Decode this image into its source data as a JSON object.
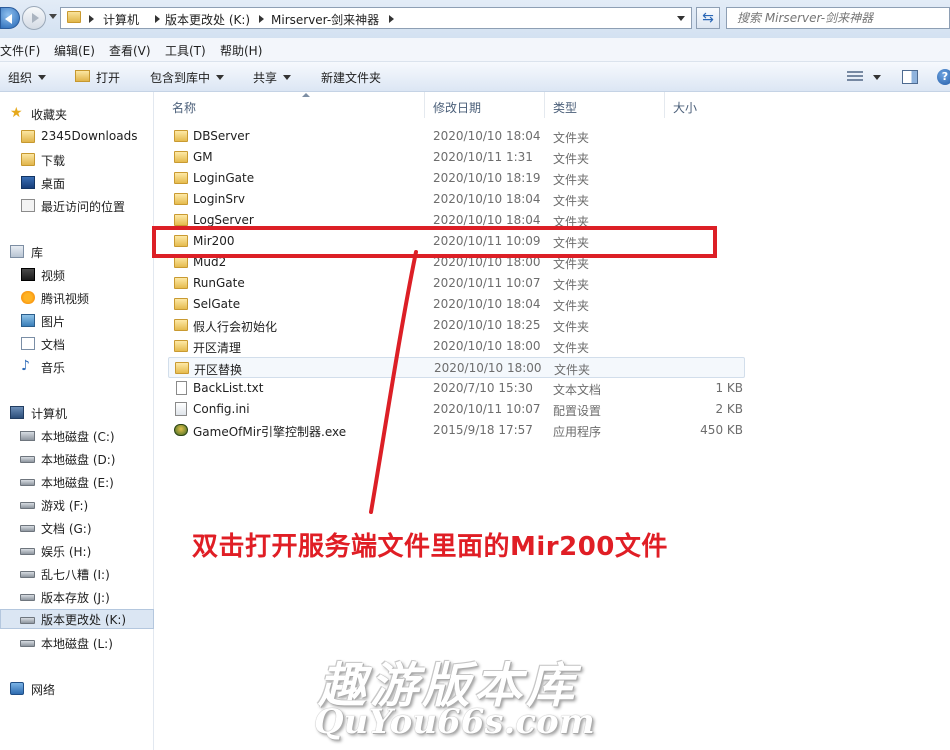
{
  "address_bar": {
    "breadcrumbs": [
      "计算机",
      "版本更改处 (K:)",
      "Mirserver-剑来神器"
    ],
    "search_placeholder": "搜索 Mirserver-剑来神器"
  },
  "menu": [
    "文件(F)",
    "编辑(E)",
    "查看(V)",
    "工具(T)",
    "帮助(H)"
  ],
  "toolbar": {
    "organize": "组织",
    "open": "打开",
    "include_library": "包含到库中",
    "share": "共享",
    "new_folder": "新建文件夹"
  },
  "sidebar": {
    "favorites": {
      "label": "收藏夹",
      "items": [
        "2345Downloads",
        "下载",
        "桌面",
        "最近访问的位置"
      ]
    },
    "libraries": {
      "label": "库",
      "items": [
        "视频",
        "腾讯视频",
        "图片",
        "文档",
        "音乐"
      ]
    },
    "computer": {
      "label": "计算机",
      "items": [
        "本地磁盘 (C:)",
        "本地磁盘 (D:)",
        "本地磁盘 (E:)",
        "游戏 (F:)",
        "文档 (G:)",
        "娱乐 (H:)",
        "乱七八糟 (I:)",
        "版本存放 (J:)",
        "版本更改处 (K:)",
        "本地磁盘 (L:)"
      ],
      "selected": "版本更改处 (K:)"
    },
    "network": {
      "label": "网络"
    }
  },
  "columns": {
    "name": "名称",
    "date": "修改日期",
    "type": "类型",
    "size": "大小"
  },
  "files": [
    {
      "name": "DBServer",
      "date": "2020/10/10 18:04",
      "type": "文件夹",
      "size": "",
      "icon": "folder"
    },
    {
      "name": "GM",
      "date": "2020/10/11 1:31",
      "type": "文件夹",
      "size": "",
      "icon": "folder"
    },
    {
      "name": "LoginGate",
      "date": "2020/10/10 18:19",
      "type": "文件夹",
      "size": "",
      "icon": "folder"
    },
    {
      "name": "LoginSrv",
      "date": "2020/10/10 18:04",
      "type": "文件夹",
      "size": "",
      "icon": "folder"
    },
    {
      "name": "LogServer",
      "date": "2020/10/10 18:04",
      "type": "文件夹",
      "size": "",
      "icon": "folder"
    },
    {
      "name": "Mir200",
      "date": "2020/10/11 10:09",
      "type": "文件夹",
      "size": "",
      "icon": "folder"
    },
    {
      "name": "Mud2",
      "date": "2020/10/10 18:00",
      "type": "文件夹",
      "size": "",
      "icon": "folder"
    },
    {
      "name": "RunGate",
      "date": "2020/10/11 10:07",
      "type": "文件夹",
      "size": "",
      "icon": "folder"
    },
    {
      "name": "SelGate",
      "date": "2020/10/10 18:04",
      "type": "文件夹",
      "size": "",
      "icon": "folder"
    },
    {
      "name": "假人行会初始化",
      "date": "2020/10/10 18:25",
      "type": "文件夹",
      "size": "",
      "icon": "folder"
    },
    {
      "name": "开区清理",
      "date": "2020/10/10 18:00",
      "type": "文件夹",
      "size": "",
      "icon": "folder"
    },
    {
      "name": "开区替换",
      "date": "2020/10/10 18:00",
      "type": "文件夹",
      "size": "",
      "icon": "folder"
    },
    {
      "name": "BackList.txt",
      "date": "2020/7/10 15:30",
      "type": "文本文档",
      "size": "1 KB",
      "icon": "txt"
    },
    {
      "name": "Config.ini",
      "date": "2020/10/11 10:07",
      "type": "配置设置",
      "size": "2 KB",
      "icon": "ini"
    },
    {
      "name": "GameOfMir引擎控制器.exe",
      "date": "2015/9/18 17:57",
      "type": "应用程序",
      "size": "450 KB",
      "icon": "exe"
    }
  ],
  "annotation": {
    "text": "双击打开服务端文件里面的Mir200文件",
    "color": "#e01e25"
  },
  "watermark": {
    "cn": "趣游版本库",
    "en": "QuYou66s.com"
  }
}
